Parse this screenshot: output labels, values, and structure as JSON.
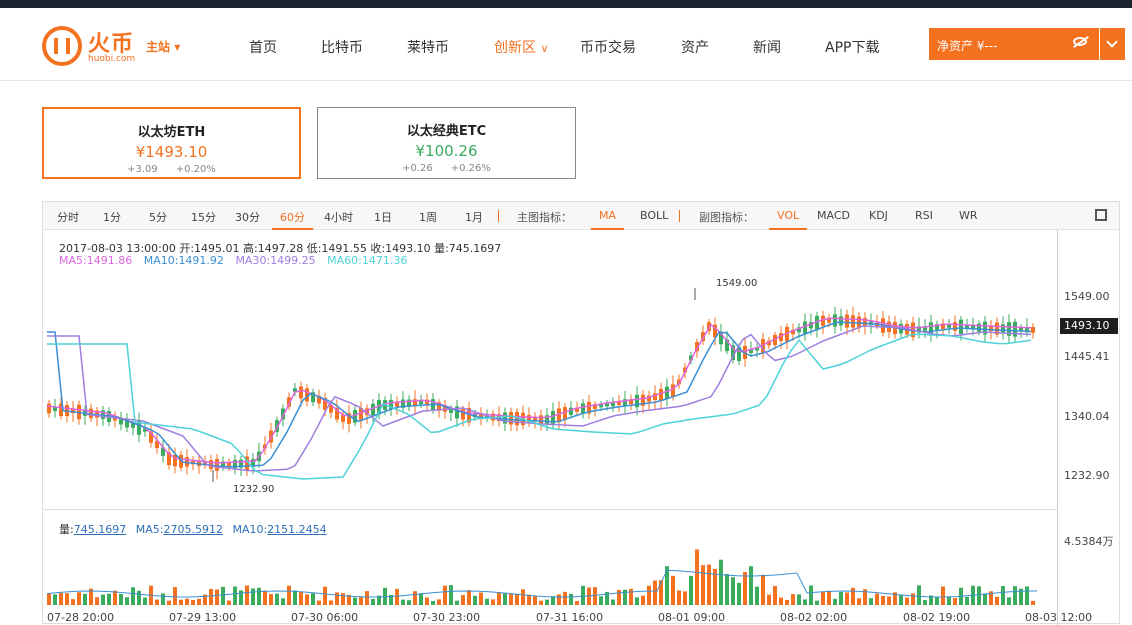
{
  "nav": {
    "logo_cn": "火币",
    "logo_en": "huobi.com",
    "site": "主站",
    "items": [
      "首页",
      "比特币",
      "莱特币",
      "创新区",
      "币币交易",
      "资产",
      "新闻",
      "APP下载"
    ],
    "assets_label": "净资产 ¥---"
  },
  "cards": [
    {
      "name": "以太坊ETH",
      "price": "¥1493.10",
      "chg": "+3.09",
      "pct": "+0.20%"
    },
    {
      "name": "以太经典ETC",
      "price": "¥100.26",
      "chg": "+0.26",
      "pct": "+0.26%"
    }
  ],
  "toolbar": {
    "periods": [
      "分时",
      "1分",
      "5分",
      "15分",
      "30分",
      "60分",
      "4小时",
      "1日",
      "1周",
      "1月"
    ],
    "main_label": "主图指标：",
    "main_indicators": [
      "MA",
      "BOLL"
    ],
    "sub_label": "副图指标：",
    "sub_indicators": [
      "VOL",
      "MACD",
      "KDJ",
      "RSI",
      "WR"
    ]
  },
  "ohlc": {
    "line": "2017-08-03 13:00:00  开:1495.01  高:1497.28  低:1491.55  收:1493.10  量:745.1697",
    "ma5": "MA5:1491.86",
    "ma10": "MA10:1491.92",
    "ma30": "MA30:1499.25",
    "ma60": "MA60:1471.36"
  },
  "vol": {
    "label": "量:",
    "value": "745.1697",
    "ma5_label": "MA5:",
    "ma5": "2705.5912",
    "ma10_label": "MA10:",
    "ma10": "2151.2454"
  },
  "axis": {
    "y_labels": [
      "1549.00",
      "1445.41",
      "1340.04",
      "1232.90"
    ],
    "current": "1493.10",
    "vol_max": "4.5384万",
    "x_labels": [
      "07-28 20:00",
      "07-29 13:00",
      "07-30 06:00",
      "07-30 23:00",
      "07-31 16:00",
      "08-01 09:00",
      "08-02 02:00",
      "08-02 19:00",
      "08-03 12:00"
    ],
    "high_mark": "1549.00",
    "low_mark": "1232.90"
  },
  "colors": {
    "up": "#3bab5e",
    "down": "#f3711f",
    "ma5": "#e065e0",
    "ma10": "#3b8fd4",
    "ma30": "#a07ee0",
    "ma60": "#4dd2d9"
  }
}
